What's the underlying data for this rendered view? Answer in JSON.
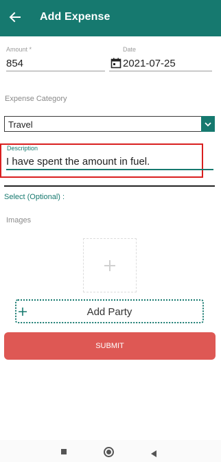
{
  "header": {
    "title": "Add Expense",
    "back_icon": "arrow-left-icon",
    "color": "#16796f"
  },
  "amount": {
    "label": "Amount *",
    "value": "854"
  },
  "date": {
    "label": "Date",
    "value": "2021-07-25",
    "icon": "calendar-icon"
  },
  "category": {
    "label": "Expense Category",
    "selected": "Travel",
    "arrow_icon": "chevron-down-icon"
  },
  "description": {
    "label": "Description",
    "value": "I have spent the amount in fuel.",
    "highlight_color": "#d91f1f"
  },
  "select_optional": {
    "label": "Select (Optional) :"
  },
  "images": {
    "label": "Images",
    "add_icon": "plus-icon"
  },
  "add_party": {
    "label": "Add Party",
    "icon": "plus-icon"
  },
  "submit": {
    "label": "SUBMIT",
    "color": "#de5854"
  },
  "system_nav": {
    "recents_icon": "square-icon",
    "home_icon": "circle-icon",
    "back_icon": "triangle-back-icon"
  }
}
